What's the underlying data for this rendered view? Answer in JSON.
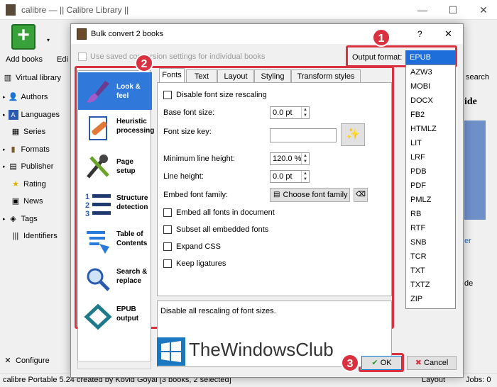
{
  "window": {
    "title": "calibre — || Calibre Library ||"
  },
  "toolbar": {
    "add_books": "Add books",
    "edit": "Edi"
  },
  "sidebar": {
    "virtual_library": "Virtual library",
    "items": [
      "Authors",
      "Languages",
      "Series",
      "Formats",
      "Publisher",
      "Rating",
      "News",
      "Tags",
      "Identifiers"
    ],
    "configure": "Configure"
  },
  "right_bits": {
    "search": "search",
    "ide": "ide",
    "er": "er",
    "de": "de"
  },
  "statusbar": {
    "text": "calibre Portable 5.24 created by Kovid Goyal   [3 books, 2 selected]",
    "layout": "Layout",
    "jobs": "Jobs: 0"
  },
  "dialog": {
    "title": "Bulk convert 2 books",
    "help": "?",
    "close": "✕",
    "use_saved": "Use saved conversion settings for individual books",
    "output_format_label": "Output format:",
    "output_format_value": "EPUB",
    "formats": [
      "AZW3",
      "MOBI",
      "DOCX",
      "FB2",
      "HTMLZ",
      "LIT",
      "LRF",
      "PDB",
      "PDF",
      "PMLZ",
      "RB",
      "RTF",
      "SNB",
      "TCR",
      "TXT",
      "TXTZ",
      "ZIP"
    ],
    "categories": [
      {
        "label": "Look & feel",
        "icon": "brush-icon",
        "selected": true
      },
      {
        "label": "Heuristic processing",
        "icon": "bandaid-document-icon",
        "selected": false
      },
      {
        "label": "Page setup",
        "icon": "tools-icon",
        "selected": false
      },
      {
        "label": "Structure detection",
        "icon": "numbered-list-icon",
        "selected": false
      },
      {
        "label": "Table of Contents",
        "icon": "toc-icon",
        "selected": false
      },
      {
        "label": "Search & replace",
        "icon": "magnifier-icon",
        "selected": false
      },
      {
        "label": "EPUB output",
        "icon": "epub-icon",
        "selected": false
      }
    ],
    "tabs": [
      "Fonts",
      "Text",
      "Layout",
      "Styling",
      "Transform styles"
    ],
    "fonts_tab": {
      "disable_rescaling": "Disable font size rescaling",
      "base_font_size_label": "Base font size:",
      "base_font_size": "0.0 pt",
      "font_size_key_label": "Font size key:",
      "font_size_key": "",
      "min_line_height_label": "Minimum line height:",
      "min_line_height": "120.0 %",
      "line_height_label": "Line height:",
      "line_height": "0.0 pt",
      "embed_family_label": "Embed font family:",
      "choose_font_family": "Choose font family",
      "embed_all": "Embed all fonts in document",
      "subset_all": "Subset all embedded fonts",
      "expand_css": "Expand CSS",
      "keep_ligatures": "Keep ligatures"
    },
    "description": "Disable all rescaling of font sizes.",
    "ok": "OK",
    "cancel": "Cancel"
  },
  "callouts": [
    "1",
    "2",
    "3"
  ],
  "watermark": "TheWindowsClub",
  "colors": {
    "accent": "#1d6ddb",
    "callout": "#d9313f",
    "selected_category": "#3078d9"
  }
}
